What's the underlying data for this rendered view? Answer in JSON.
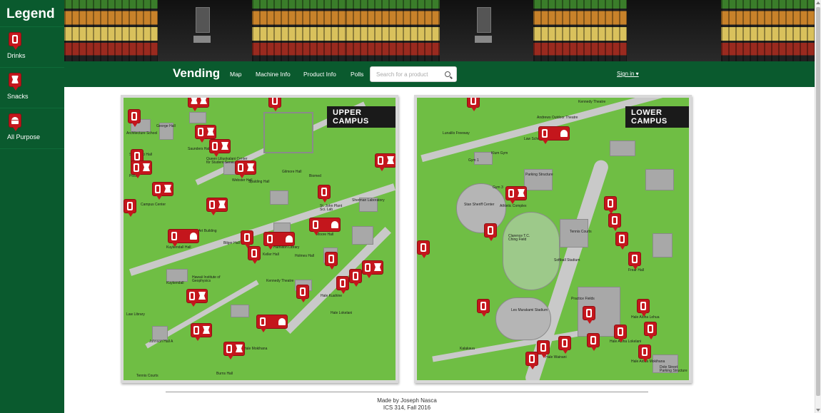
{
  "legend": {
    "title": "Legend",
    "items": [
      {
        "label": "Drinks",
        "icon": "drink-marker-icon"
      },
      {
        "label": "Snacks",
        "icon": "snack-marker-icon"
      },
      {
        "label": "All Purpose",
        "icon": "all-purpose-marker-icon"
      }
    ]
  },
  "navbar": {
    "brand": "Vending",
    "links": [
      "Map",
      "Machine Info",
      "Product Info",
      "Polls"
    ],
    "search_placeholder": "Search for a product",
    "signin": "Sign in ▾"
  },
  "maps": {
    "upper": {
      "title": "UPPER CAMPUS"
    },
    "lower": {
      "title": "LOWER CAMPUS"
    }
  },
  "upper_labels": [
    "Architecture School",
    "George Hall",
    "Sakamaki Hall",
    "Saunders Hall",
    "Queen Liliuokalani Center for Student Services",
    "Webster Hall",
    "Spalding Hall",
    "Hamilton Library",
    "Holmes Hall",
    "Kennedy Theatre",
    "Art Building",
    "Hawaii Institute of Geophysics",
    "Keller Hall",
    "St. John Plant Sci. Lab",
    "Moore Hall",
    "Campus Center",
    "Kuykendall Hall",
    "Hale Kuahine",
    "Hale Lokelani",
    "Hale Mokihana",
    "Burns Hall",
    "Tennis Courts",
    "Law Library",
    "Biomed",
    "Gilmore Hall",
    "Bilger Hall",
    "Post",
    "Johnson Hall A",
    "Sherman Laboratory",
    "Kuykendall"
  ],
  "lower_labels": [
    "Lunalilo Freeway",
    "Gym 1",
    "Klum Gym",
    "Gym 3",
    "Parking Structure",
    "Clarence T.C. Ching Field",
    "Softball Stadium",
    "Les Murakami Stadium",
    "Stan Sheriff Center",
    "Athletic Complex",
    "Hale Aloha Lehua",
    "Hale Aloha Lokelani",
    "Hale Aloha Mokihana",
    "Hale Wainani",
    "Frear Hall",
    "Dole Street Parking Structure",
    "Andrews Outdoor Theatre",
    "Kennedy Theatre",
    "Law School",
    "Practice Fields",
    "Tennis Courts",
    "Kalakaua"
  ],
  "footer": {
    "line1": "Made by Joseph Nasca",
    "line2": "ICS 314, Fall 2016"
  },
  "colors": {
    "primary_green": "#0a5a2e",
    "marker_red": "#c4161c",
    "map_green": "#6fbe44"
  }
}
